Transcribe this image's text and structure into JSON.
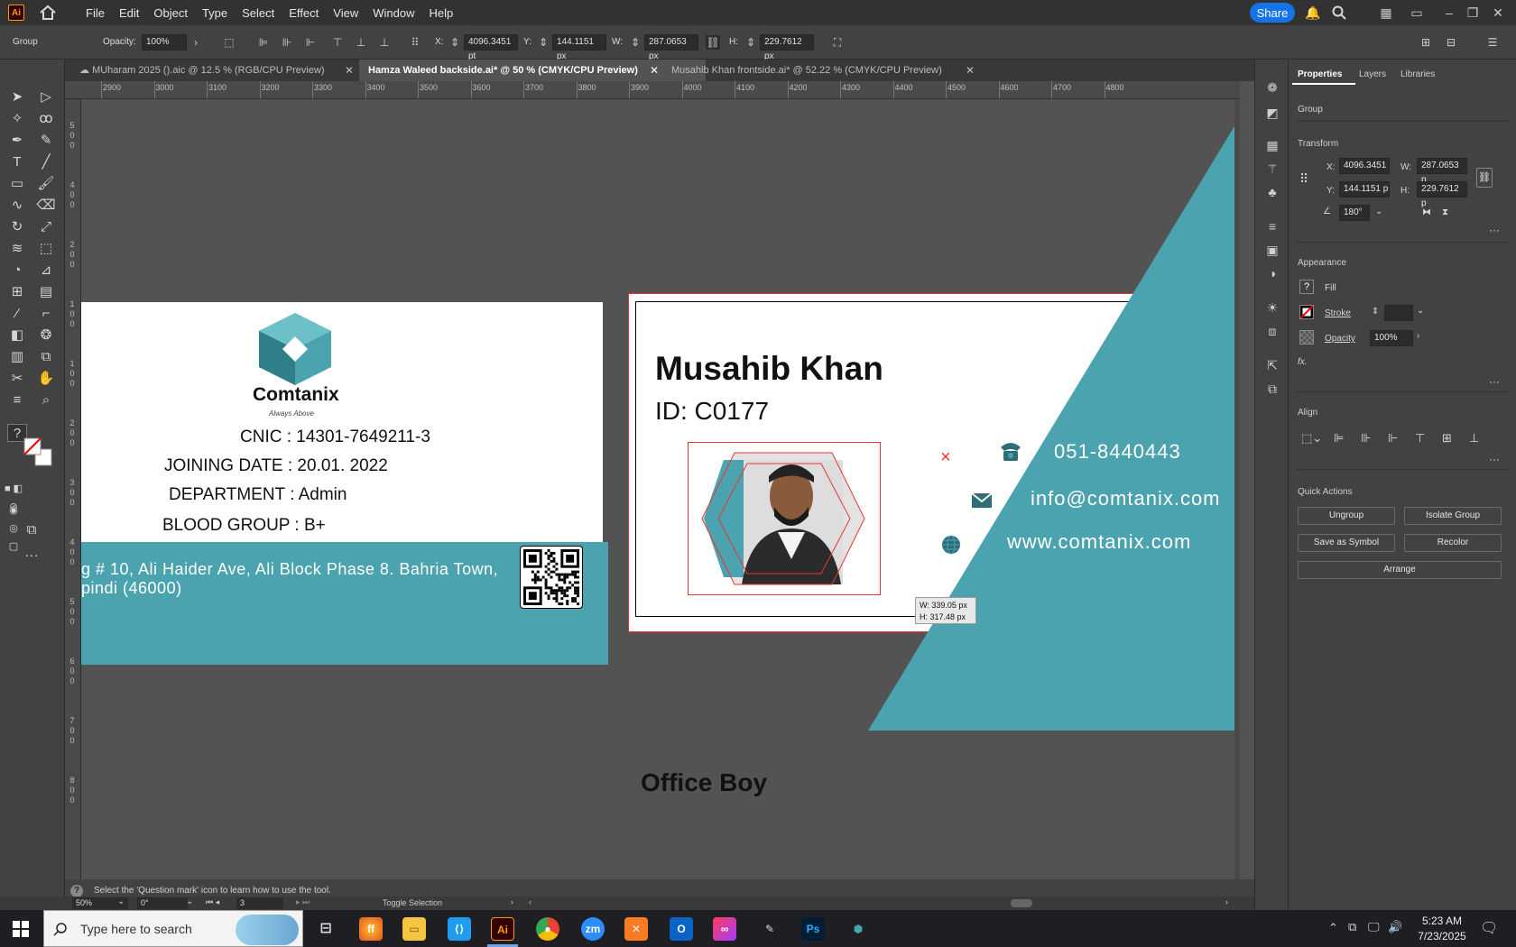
{
  "app": {
    "menu": [
      "File",
      "Edit",
      "Object",
      "Type",
      "Select",
      "Effect",
      "View",
      "Window",
      "Help"
    ],
    "share_label": "Share",
    "logo_text": "Ai"
  },
  "controlbar": {
    "selection_type": "Group",
    "opacity_label": "Opacity:",
    "opacity_value": "100%",
    "x_label": "X:",
    "x_value": "4096.3451 pt",
    "y_label": "Y:",
    "y_value": "144.1151 px",
    "w_label": "W:",
    "w_value": "287.0653 px",
    "h_label": "H:",
    "h_value": "229.7612 px"
  },
  "tabs": [
    {
      "label": "MUharam 2025 ().aic @ 12.5 % (RGB/CPU Preview)",
      "active": false
    },
    {
      "label": "Hamza Waleed backside.ai* @ 50 % (CMYK/CPU Preview)",
      "active": true
    },
    {
      "label": "Musahib Khan  frontside.ai* @ 52.22 % (CMYK/CPU Preview)",
      "active": false
    }
  ],
  "ruler": {
    "h_ticks": [
      "2900",
      "3000",
      "3100",
      "3200",
      "3300",
      "3400",
      "3500",
      "3600",
      "3700",
      "3800",
      "3900",
      "4000",
      "4100",
      "4200",
      "4300",
      "4400",
      "4500",
      "4600",
      "4700",
      "4800"
    ],
    "v_ticks": [
      "500",
      "400",
      "200",
      "100",
      "100",
      "200",
      "300",
      "400",
      "500",
      "600",
      "700",
      "800"
    ]
  },
  "card_back": {
    "company": "Comtanix",
    "tagline": "Always Above",
    "cnic": "CNIC : 14301-7649211-3",
    "joining": "JOINING DATE : 20.01. 2022",
    "department": "DEPARTMENT : Admin",
    "blood": "BLOOD GROUP : B+",
    "address_line1": "g # 10, Ali Haider Ave, Ali Block Phase 8. Bahria Town,",
    "address_line2": "pindi (46000)"
  },
  "card_front": {
    "name": "Musahib Khan",
    "id": "ID: C0177",
    "phone": "051-8440443",
    "email": "info@comtanix.com",
    "website": "www.comtanix.com",
    "role": "Office Boy",
    "tooltip_w": "W: 339.05 px",
    "tooltip_h": "H: 317.48 px",
    "accent": "#4aa3ae"
  },
  "properties": {
    "tabs": [
      "Properties",
      "Layers",
      "Libraries"
    ],
    "selection": "Group",
    "transform_title": "Transform",
    "x_label": "X:",
    "x_value": "4096.3451",
    "y_label": "Y:",
    "y_value": "144.1151 p",
    "w_label": "W:",
    "w_value": "287.0653 p",
    "h_label": "H:",
    "h_value": "229.7612 p",
    "angle": "180°",
    "appearance_title": "Appearance",
    "fill_label": "Fill",
    "stroke_label": "Stroke",
    "opacity_label": "Opacity",
    "opacity_value": "100%",
    "fx_label": "fx.",
    "align_title": "Align",
    "quick_actions_title": "Quick Actions",
    "btn_ungroup": "Ungroup",
    "btn_isolate": "Isolate Group",
    "btn_symbol": "Save as Symbol",
    "btn_recolor": "Recolor",
    "btn_arrange": "Arrange"
  },
  "status": {
    "hint": "Select the 'Question mark' icon to learn how to use the tool.",
    "zoom": "50%",
    "rotation": "0°",
    "artboard": "3",
    "toggle": "Toggle Selection"
  },
  "taskbar": {
    "search_placeholder": "Type here to search",
    "time": "5:23 AM",
    "date": "7/23/2025"
  }
}
